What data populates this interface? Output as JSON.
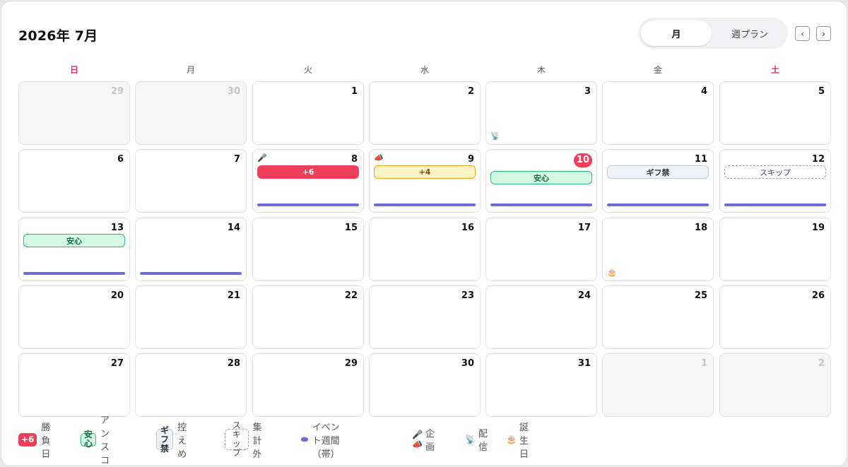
{
  "header": {
    "title": "2026年 7月",
    "view_month": "月",
    "view_week": "週プラン",
    "prev": "‹",
    "next": "›"
  },
  "weekdays": [
    "日",
    "月",
    "火",
    "水",
    "木",
    "金",
    "土"
  ],
  "colors": {
    "win": "#f03e5b",
    "anshin": "#2fb87a",
    "gift": "#c3cad6",
    "band": "#6f6bdc",
    "weekend": "#d6336c"
  },
  "weeks": [
    [
      {
        "day": "29",
        "out": true
      },
      {
        "day": "30",
        "out": true
      },
      {
        "day": "1"
      },
      {
        "day": "2"
      },
      {
        "day": "3",
        "icon_bottom": "📡",
        "icon_name": "satellite-icon"
      },
      {
        "day": "4"
      },
      {
        "day": "5"
      }
    ],
    [
      {
        "day": "6"
      },
      {
        "day": "7"
      },
      {
        "day": "8",
        "icon_top": "🎤",
        "icon_name": "microphone-icon",
        "pill": {
          "type": "win",
          "label": "+6"
        },
        "band": true
      },
      {
        "day": "9",
        "icon_top": "📣",
        "icon_name": "megaphone-icon",
        "pill": {
          "type": "yellow",
          "label": "+4"
        },
        "band": true
      },
      {
        "day": "10",
        "today": true,
        "pill": {
          "type": "green",
          "label": "安心"
        },
        "band": true
      },
      {
        "day": "11",
        "pill": {
          "type": "gift",
          "label": "ギフ禁"
        },
        "band": true
      },
      {
        "day": "12",
        "pill": {
          "type": "skip",
          "label": "スキップ"
        },
        "band": true
      }
    ],
    [
      {
        "day": "13",
        "pill": {
          "type": "green",
          "label": "安心"
        },
        "band": true
      },
      {
        "day": "14",
        "band": true
      },
      {
        "day": "15"
      },
      {
        "day": "16"
      },
      {
        "day": "17"
      },
      {
        "day": "18",
        "icon_bottom": "🎂",
        "icon_name": "birthday-cake-icon"
      },
      {
        "day": "19"
      }
    ],
    [
      {
        "day": "20"
      },
      {
        "day": "21"
      },
      {
        "day": "22"
      },
      {
        "day": "23"
      },
      {
        "day": "24"
      },
      {
        "day": "25"
      },
      {
        "day": "26"
      }
    ],
    [
      {
        "day": "27"
      },
      {
        "day": "28"
      },
      {
        "day": "29"
      },
      {
        "day": "30"
      },
      {
        "day": "31"
      },
      {
        "day": "1",
        "out": true
      },
      {
        "day": "2",
        "out": true
      }
    ]
  ],
  "legend": {
    "win_chip": "+6",
    "win_label": "勝負日",
    "anshin_chip": "安心",
    "anshin_label": "アンスコ",
    "gift_chip": "ギフ禁",
    "gift_label": "控えめ",
    "skip_chip": "スキップ",
    "skip_label": "集計外",
    "band_label": "イベント週間（帯）",
    "plan_icons": "🎤📣",
    "plan_label": "企画",
    "stream_icon": "📡",
    "stream_label": "配信",
    "birthday_icon": "🎂",
    "birthday_label": "誕生日"
  }
}
